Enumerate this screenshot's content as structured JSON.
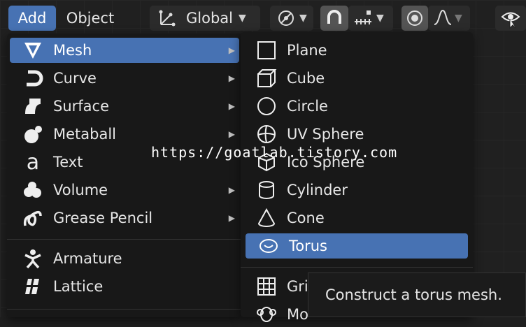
{
  "header": {
    "add_label": "Add",
    "object_label": "Object",
    "transform_orientation": "Global"
  },
  "add_menu": {
    "items": [
      {
        "label": "Mesh",
        "icon": "mesh-icon",
        "submenu": true,
        "highlighted": true
      },
      {
        "label": "Curve",
        "icon": "curve-icon",
        "submenu": true
      },
      {
        "label": "Surface",
        "icon": "surface-icon",
        "submenu": true
      },
      {
        "label": "Metaball",
        "icon": "metaball-icon",
        "submenu": true
      },
      {
        "label": "Text",
        "icon": "text-icon",
        "submenu": false
      },
      {
        "label": "Volume",
        "icon": "volume-icon",
        "submenu": true
      },
      {
        "label": "Grease Pencil",
        "icon": "grease-pencil-icon",
        "submenu": true
      },
      {
        "label": "Armature",
        "icon": "armature-icon",
        "submenu": false
      },
      {
        "label": "Lattice",
        "icon": "lattice-icon",
        "submenu": false
      }
    ]
  },
  "mesh_menu": {
    "items": [
      {
        "label": "Plane",
        "icon": "plane-icon"
      },
      {
        "label": "Cube",
        "icon": "cube-icon"
      },
      {
        "label": "Circle",
        "icon": "circle-icon"
      },
      {
        "label": "UV Sphere",
        "icon": "uv-sphere-icon"
      },
      {
        "label": "Ico Sphere",
        "icon": "ico-sphere-icon"
      },
      {
        "label": "Cylinder",
        "icon": "cylinder-icon"
      },
      {
        "label": "Cone",
        "icon": "cone-icon"
      },
      {
        "label": "Torus",
        "icon": "torus-icon",
        "highlighted": true
      },
      {
        "label": "Gri",
        "icon": "grid-icon"
      },
      {
        "label": "Mo",
        "icon": "monkey-icon"
      }
    ]
  },
  "tooltip": {
    "text": "Construct a torus mesh."
  },
  "watermark": {
    "text": "https://goatlab.tistory.com"
  },
  "colors": {
    "accent": "#4772b3",
    "menu_bg": "#181818",
    "header_bg": "#2b2b2b"
  }
}
